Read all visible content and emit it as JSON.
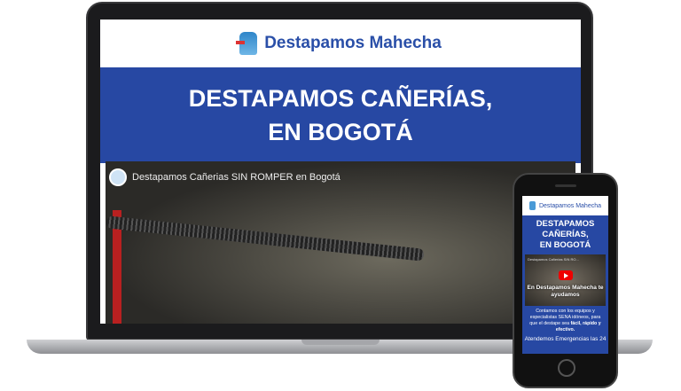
{
  "laptop": {
    "brand": "Destapamos Mahecha",
    "hero_line1": "DESTAPAMOS CAÑERÍAS,",
    "hero_line2": "EN BOGOTÁ",
    "video_title": "Destapamos Cañerias SIN ROMPER en Bogotá"
  },
  "phone": {
    "brand": "Destapamos Mahecha",
    "title_line1": "DESTAPAMOS",
    "title_line2": "CAÑERÍAS,",
    "title_line3": "EN BOGOTÁ",
    "video_title": "Destapamos Cañerias SIN RO...",
    "video_overlay": "En Destapamos Mahecha te ayudamos",
    "body_text": "Contamos con los equipos y especialistas SENA idóneos, para que el destape sea",
    "body_bold": "fácil, rápido y efectivo.",
    "footer_text": "Atendemos Emergencias las 24"
  },
  "colors": {
    "primary": "#2748a3",
    "brand_text": "#2a4fa8",
    "play": "#ee0000"
  }
}
